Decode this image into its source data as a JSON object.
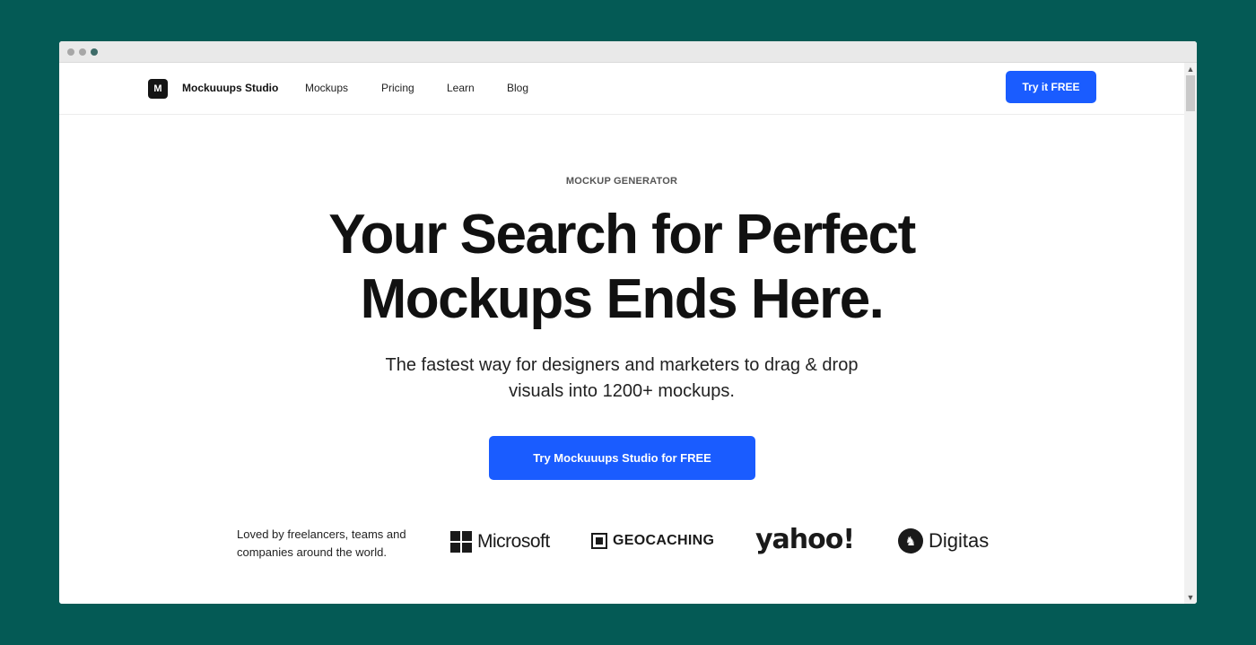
{
  "nav": {
    "logo_letter": "M",
    "brand": "Mockuuups Studio",
    "links": [
      "Mockups",
      "Pricing",
      "Learn",
      "Blog"
    ],
    "cta": "Try it FREE"
  },
  "hero": {
    "eyebrow": "MOCKUP GENERATOR",
    "headline_lines": [
      "Your Search for Perfect",
      "Mockups Ends Here."
    ],
    "subhead_lines": [
      "The fastest way for designers and marketers to drag & drop",
      "visuals into 1200+ mockups."
    ],
    "cta": "Try Mockuuups Studio for FREE"
  },
  "social_proof": {
    "text_lines": [
      "Loved by freelancers, teams and",
      "companies around the world."
    ],
    "logos": [
      "Microsoft",
      "GEOCACHING",
      "yahoo!",
      "Digitas"
    ]
  },
  "colors": {
    "background": "#045a55",
    "accent": "#1a5cff"
  }
}
